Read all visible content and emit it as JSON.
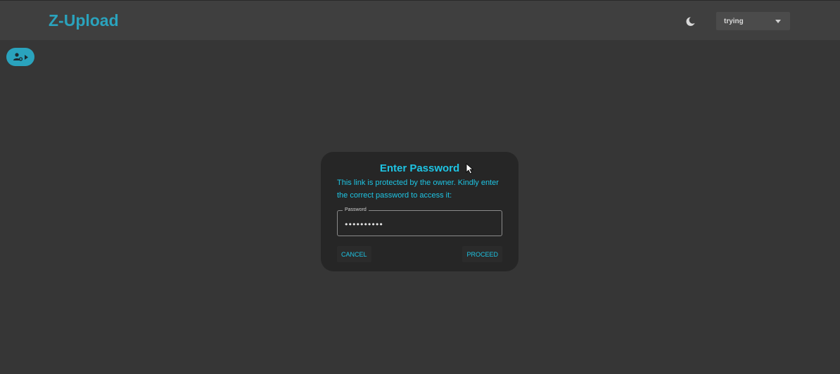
{
  "header": {
    "brand": "Z-Upload",
    "theme_icon": "moon-icon",
    "user_select": {
      "value": "trying"
    }
  },
  "fab": {
    "icons": [
      "user-settings-icon",
      "chevron-right-icon"
    ]
  },
  "dialog": {
    "title": "Enter Password",
    "message": "This link is protected by the owner. Kindly enter the correct password to access it:",
    "password": {
      "label": "Password",
      "value": "••••••••••"
    },
    "cancel_label": "CANCEL",
    "proceed_label": "PROCEED"
  },
  "colors": {
    "accent": "#1ec4e3",
    "brand": "#2aa3bd",
    "background": "#363636",
    "topbar": "#3f3f3f",
    "dialog": "#262626"
  }
}
